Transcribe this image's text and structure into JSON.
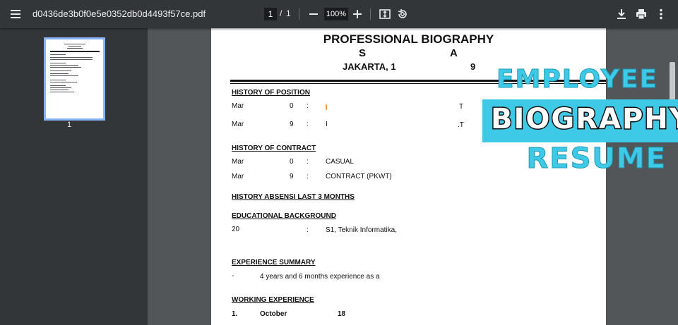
{
  "toolbar": {
    "file_name": "d0436de3b0f0e5e0352db0d4493f57ce.pdf",
    "current_page": "1",
    "page_separator": "/",
    "total_pages": "1",
    "zoom": "100%",
    "icons": [
      "menu-icon",
      "zoom-out-icon",
      "zoom-in-icon",
      "fit-page-icon",
      "rotate-icon",
      "download-icon",
      "print-icon",
      "more-vert-icon"
    ]
  },
  "sidebar": {
    "thumbnail_label": "1",
    "accent": "#8ab4f8"
  },
  "document": {
    "title": "PROFESSIONAL BIOGRAPHY",
    "subtitle_left": "S",
    "subtitle_right": "A",
    "location_left": "JAKARTA, 1",
    "location_right": "9",
    "sections": {
      "position": {
        "heading": "HISTORY OF POSITION",
        "rows": [
          {
            "month": "Mar",
            "year": "0",
            "colon": ":",
            "value": "I",
            "tail": "T"
          },
          {
            "month": "Mar",
            "year": "9",
            "colon": ":",
            "value": "I",
            "tail": ".T"
          }
        ]
      },
      "contract": {
        "heading": "HISTORY OF CONTRACT",
        "rows": [
          {
            "month": "Mar",
            "year": "0",
            "colon": ":",
            "value": "CASUAL"
          },
          {
            "month": "Mar",
            "year": "9",
            "colon": ":",
            "value": "CONTRACT (PKWT)"
          }
        ]
      },
      "absensi": {
        "heading": "HISTORY ABSENSI LAST 3 MONTHS"
      },
      "education": {
        "heading": "EDUCATIONAL BACKGROUND",
        "rows": [
          {
            "year": "20",
            "colon": ":",
            "value": "S1, Teknik Informatika,"
          }
        ]
      },
      "experience": {
        "heading": "EXPERIENCE SUMMARY",
        "rows": [
          {
            "dash": "-",
            "value": "4 years and 6 months experience as a"
          }
        ]
      },
      "working": {
        "heading": "WORKING EXPERIENCE",
        "rows": [
          {
            "num": "1.",
            "month": "October",
            "year": "18"
          }
        ]
      }
    }
  },
  "overlay": {
    "line1": "EMPLOYEE",
    "line2_main": "BIOGRA",
    "line2_tail": "PHY",
    "line3": "RESUME",
    "accent": "#3ec9e6"
  }
}
